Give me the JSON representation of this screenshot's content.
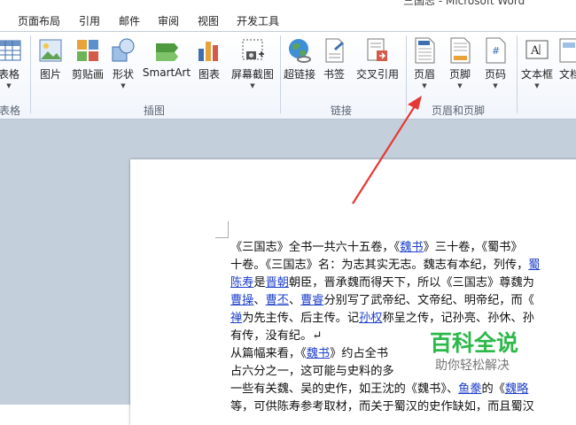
{
  "window": {
    "title": "三国志 - Microsoft Word"
  },
  "menu": [
    {
      "label": "页面布局"
    },
    {
      "label": "引用"
    },
    {
      "label": "邮件"
    },
    {
      "label": "审阅"
    },
    {
      "label": "视图"
    },
    {
      "label": "开发工具"
    }
  ],
  "ribbon": {
    "buttons": [
      {
        "label": "表格",
        "icon": "table-icon"
      },
      {
        "label": "图片",
        "icon": "picture-icon"
      },
      {
        "label": "剪贴画",
        "icon": "clipart-icon"
      },
      {
        "label": "形状",
        "icon": "shapes-icon"
      },
      {
        "label": "SmartArt",
        "icon": "smartart-icon"
      },
      {
        "label": "图表",
        "icon": "chart-icon"
      },
      {
        "label": "屏幕截图",
        "icon": "screenshot-icon"
      },
      {
        "label": "超链接",
        "icon": "hyperlink-globe-icon"
      },
      {
        "label": "书签",
        "icon": "bookmark-icon"
      },
      {
        "label": "交叉引用",
        "icon": "crossref-icon"
      },
      {
        "label": "页眉",
        "icon": "header-icon"
      },
      {
        "label": "页脚",
        "icon": "footer-icon"
      },
      {
        "label": "页码",
        "icon": "page-number-icon"
      },
      {
        "label": "文本框",
        "icon": "textbox-icon"
      },
      {
        "label": "文档",
        "icon": "document-parts-icon"
      }
    ],
    "groups": [
      {
        "label": "表格"
      },
      {
        "label": "插图"
      },
      {
        "label": "链接"
      },
      {
        "label": "页眉和页脚"
      }
    ]
  },
  "document": {
    "lines": [
      [
        "《三国志》全书一共六十五卷，《",
        {
          "link": "魏书"
        },
        "》三十卷，《蜀书》"
      ],
      [
        "十卷。《三国志》名：为志其实无志。魏志有本纪，列传，",
        {
          "link": "蜀"
        }
      ],
      [
        {
          "link": "陈寿"
        },
        "是",
        {
          "link": "晋朝"
        },
        "朝臣，晋承魏而得天下，所以《三国志》尊魏为"
      ],
      [
        {
          "link": "曹操"
        },
        "、",
        {
          "link": "曹丕"
        },
        "、",
        {
          "link": "曹睿"
        },
        "分别写了武帝纪、文帝纪、明帝纪，而《"
      ],
      [
        {
          "link": "禅"
        },
        "为先主传、后主传。记",
        {
          "link": "孙权"
        },
        "称呈之传，记孙亮、孙休、孙"
      ],
      [
        "有传，没有纪。↵"
      ],
      [
        "从篇幅来看，《",
        {
          "link": "魏书"
        },
        "》约占全书"
      ],
      [
        "占六分之一，这可能与史料的多"
      ],
      [
        "一些有关魏、吴的史作，如王沈的《魏书》、",
        {
          "link": "鱼豢"
        },
        "的《",
        {
          "link": "魏略"
        }
      ],
      [
        "等，可供陈寿参考取材，而关于蜀汉的史作缺如，而且蜀汉"
      ]
    ]
  },
  "watermark": {
    "title": "百科全说",
    "subtitle": "助你轻松解决"
  },
  "colors": {
    "accent": "#e53935",
    "link": "#1f41c9",
    "watermark": "#2db84a"
  }
}
